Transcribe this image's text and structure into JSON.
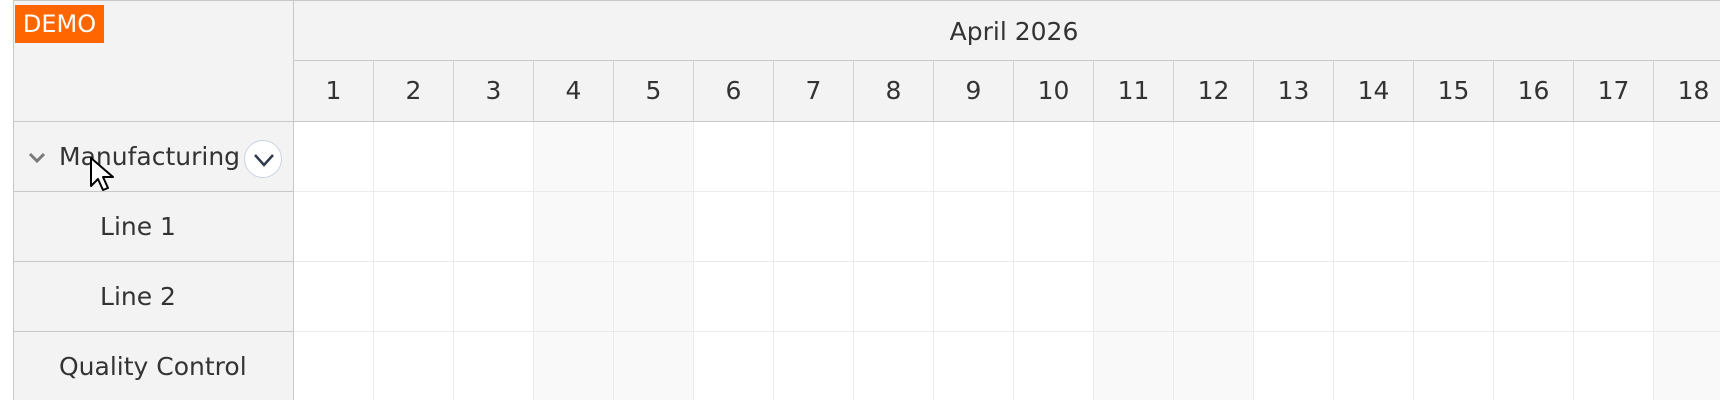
{
  "badge": {
    "label": "DEMO",
    "color": "#ff6600"
  },
  "header": {
    "month": "April 2026",
    "days": [
      "1",
      "2",
      "3",
      "4",
      "5",
      "6",
      "7",
      "8",
      "9",
      "10",
      "11",
      "12",
      "13",
      "14",
      "15",
      "16",
      "17",
      "18"
    ],
    "weekend_days": [
      "4",
      "5",
      "11",
      "12",
      "18"
    ]
  },
  "resources": [
    {
      "type": "group",
      "label": "Manufacturing",
      "expanded": true,
      "icon": "chevron-down-icon"
    },
    {
      "type": "child",
      "label": "Line 1"
    },
    {
      "type": "child",
      "label": "Line 2"
    },
    {
      "type": "group",
      "label": "Quality Control"
    }
  ],
  "row_menu": {
    "icon": "chevron-down-icon"
  }
}
